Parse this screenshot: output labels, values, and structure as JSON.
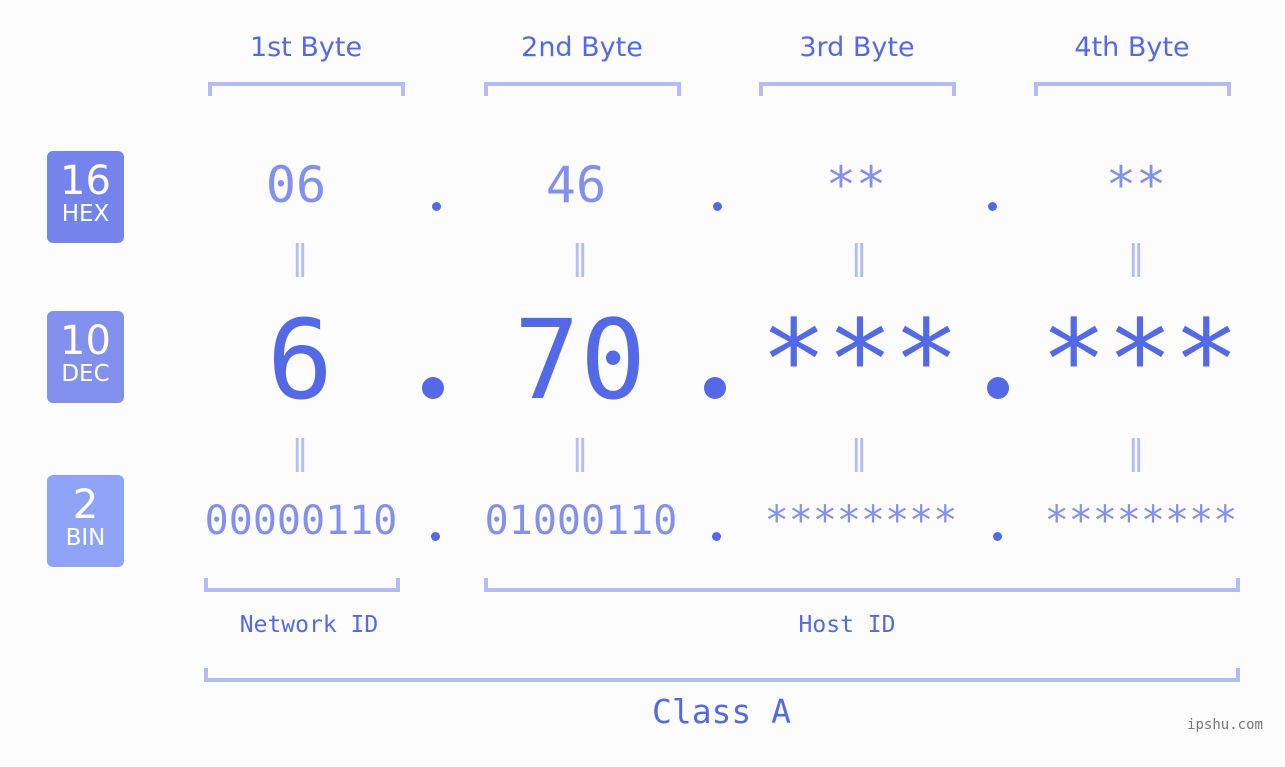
{
  "byte_headers": [
    "1st Byte",
    "2nd Byte",
    "3rd Byte",
    "4th Byte"
  ],
  "badges": [
    {
      "number": "16",
      "label": "HEX",
      "color": "#7583ec"
    },
    {
      "number": "10",
      "label": "DEC",
      "color": "#8390ee"
    },
    {
      "number": "2",
      "label": "BIN",
      "color": "#8fa4f6"
    }
  ],
  "hex": [
    "06",
    "46",
    "**",
    "**"
  ],
  "dec": [
    "6",
    "70",
    "***",
    "***"
  ],
  "bin": [
    "00000110",
    "01000110",
    "********",
    "********"
  ],
  "equals_symbol": "=",
  "network_id_label": "Network ID",
  "host_id_label": "Host ID",
  "class_label": "Class A",
  "watermark": "ipshu.com",
  "colors": {
    "accent": "#5469e6",
    "light_accent": "#8390ee",
    "bracket": "#b3bcf5"
  }
}
